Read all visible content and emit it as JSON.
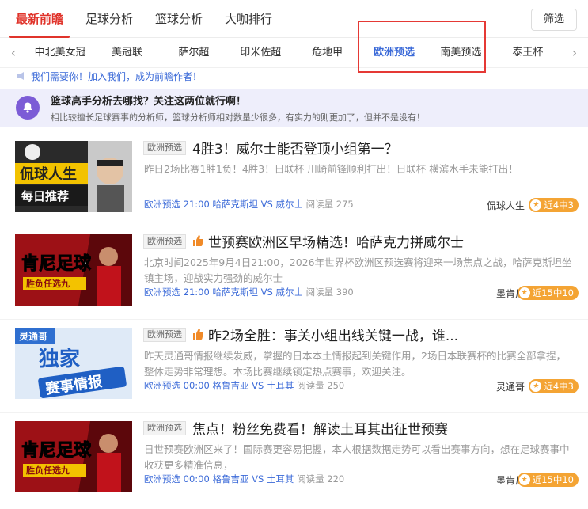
{
  "topnav": {
    "tabs": [
      {
        "label": "最新前瞻",
        "active": true
      },
      {
        "label": "足球分析",
        "active": false
      },
      {
        "label": "篮球分析",
        "active": false
      },
      {
        "label": "大咖排行",
        "active": false
      }
    ],
    "filter_label": "筛选"
  },
  "leagues": {
    "items": [
      {
        "label": "中北美女冠"
      },
      {
        "label": "美冠联"
      },
      {
        "label": "萨尔超"
      },
      {
        "label": "印米佐超"
      },
      {
        "label": "危地甲"
      },
      {
        "label": "欧洲预选"
      },
      {
        "label": "南美预选"
      },
      {
        "label": "泰王杯"
      }
    ],
    "left_arrow": "‹",
    "right_arrow": "›"
  },
  "notice": {
    "text": "我们需要你！加入我们，成为前瞻作者！"
  },
  "banner": {
    "title": "篮球高手分析去哪找？关注这两位就行啊！",
    "subtitle": "相比较擅长足球赛事的分析师，篮球分析师相对数量少很多，有实力的则更加了，但并不是没有！"
  },
  "articles": [
    {
      "tag": "欧洲预选",
      "title": "4胜3！威尔士能否登顶小组第一？",
      "excerpt": "昨日2场比赛1胜1负！4胜3！日联杯 川崎前锋顺利打出！日联杯 横滨水手未能打出！",
      "league": "欧洲预选",
      "time": "21:00",
      "match": "哈萨克斯坦 VS 威尔士",
      "reads_label": "阅读量",
      "reads": "275",
      "author": "侃球人生",
      "record": "近4中3",
      "thumb": {
        "line1": "侃球人生",
        "line2": "每日推荐"
      }
    },
    {
      "tag": "欧洲预选",
      "title": "世预赛欧洲区早场精选！哈萨克力拼威尔士",
      "excerpt": "北京时间2025年9月4日21:00，2026年世界杯欧洲区预选赛将迎来一场焦点之战，哈萨克斯坦坐镇主场，迎战实力强劲的威尔士",
      "league": "欧洲预选",
      "time": "21:00",
      "match": "哈萨克斯坦 VS 威尔士",
      "reads_label": "阅读量",
      "reads": "390",
      "author": "墨肯尼",
      "record": "近15中10",
      "thumb": {
        "line1": "肯尼足球",
        "line2": "胜负任选九"
      }
    },
    {
      "tag": "欧洲预选",
      "title": "昨2场全胜：事关小组出线关键一战，谁...",
      "excerpt": "昨天灵通哥情报继续发威，掌握的日本本土情报起到关键作用，2场日本联赛杯的比赛全部拿捏，整体走势非常理想。本场比赛继续锁定热点赛事，欢迎关注。",
      "league": "欧洲预选",
      "time": "00:00",
      "match": "格鲁吉亚 VS 土耳其",
      "reads_label": "阅读量",
      "reads": "250",
      "author": "灵通哥",
      "record": "近4中3",
      "thumb": {
        "line1": "灵通哥",
        "line2": "独家",
        "line3": "赛事情报"
      }
    },
    {
      "tag": "欧洲预选",
      "title": "焦点！粉丝免费看！解读土耳其出征世预赛",
      "excerpt": "日世预赛欧洲区来了！国际赛更容易把握，本人根据数据走势可以看出赛事方向，想在足球赛事中收获更多精准信息，",
      "league": "欧洲预选",
      "time": "00:00",
      "match": "格鲁吉亚 VS 土耳其",
      "reads_label": "阅读量",
      "reads": "220",
      "author": "墨肯尼",
      "record": "近15中10",
      "thumb": {
        "line1": "肯尼足球",
        "line2": "胜负任选九"
      }
    }
  ],
  "colors": {
    "accent": "#e0342b",
    "link": "#3b6ad8",
    "badge": "#f4a434",
    "banner_bg": "#eeeefb"
  }
}
